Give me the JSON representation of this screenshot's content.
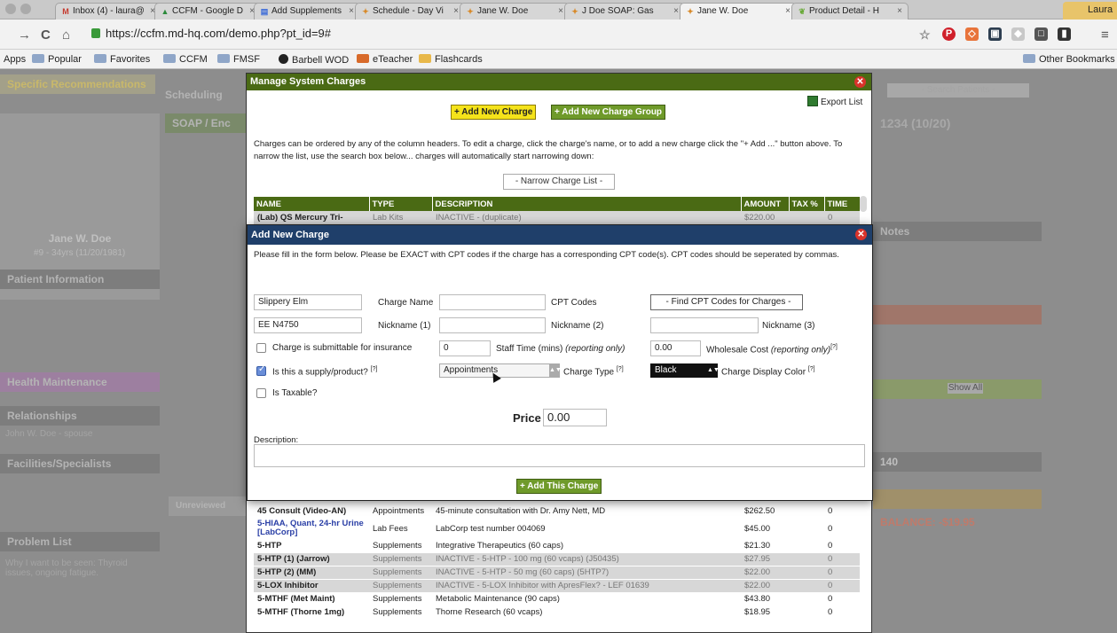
{
  "browser": {
    "tabs": [
      {
        "label": "Inbox (4) - laura@",
        "icon": "gmail-icon",
        "active": false
      },
      {
        "label": "CCFM - Google D",
        "icon": "drive-icon",
        "active": false
      },
      {
        "label": "Add Supplements",
        "icon": "docs-icon",
        "active": false
      },
      {
        "label": "Schedule - Day Vi",
        "icon": "mdhq-icon",
        "active": false
      },
      {
        "label": "Jane W. Doe",
        "icon": "mdhq-icon",
        "active": false
      },
      {
        "label": "J Doe SOAP: Gas",
        "icon": "mdhq-icon",
        "active": false
      },
      {
        "label": "Jane W. Doe",
        "icon": "mdhq-icon",
        "active": true
      },
      {
        "label": "Product Detail - H",
        "icon": "leaf-icon",
        "active": false
      }
    ],
    "profile": "Laura",
    "url": "https://ccfm.md-hq.com/demo.php?pt_id=9#",
    "bookmarks": [
      {
        "label": "Apps",
        "icon": "apps-icon"
      },
      {
        "label": "Popular",
        "icon": "folder-icon"
      },
      {
        "label": "Favorites",
        "icon": "folder-icon"
      },
      {
        "label": "CCFM",
        "icon": "folder-icon"
      },
      {
        "label": "FMSF",
        "icon": "folder-icon"
      },
      {
        "label": "Barbell WOD",
        "icon": "barbell-icon"
      },
      {
        "label": "eTeacher",
        "icon": "eteacher-icon"
      },
      {
        "label": "Flashcards",
        "icon": "flashcards-icon"
      }
    ],
    "other_bookmarks": "Other Bookmarks"
  },
  "background": {
    "specific_recommendations": "Specific Recommendations",
    "scheduling": "Scheduling",
    "soap": "SOAP / Enc",
    "patient_name": "Jane W. Doe",
    "patient_sub": "#9 - 34yrs (11/20/1981)",
    "patient_information": "Patient Information",
    "health_maintenance": "Health Maintenance",
    "relationships": "Relationships",
    "relationship_item": "John W. Doe - spouse",
    "facilities": "Facilities/Specialists",
    "problem_list": "Problem List",
    "problem_text": "Why I want to be seen: Thyroid issues, ongoing fatigue.",
    "search_placeholder": "- Search Patients -",
    "appt": "1234 (10/20)",
    "notes": "Notes",
    "unreviewed": "Unreviewed",
    "balance": "BALANCE: -$19.95",
    "vitals": "140",
    "show_all": "Show All"
  },
  "manage_charges": {
    "title": "Manage System Charges",
    "add_charge_btn": "+ Add New Charge",
    "add_group_btn": "+ Add New Charge Group",
    "export": "Export List",
    "intro": "Charges can be ordered by any of the column headers. To edit a charge, click the charge's name, or to add a new charge click the \"+ Add ...\" button above. To narrow the list, use the search box below... charges will automatically start narrowing down:",
    "narrow": "- Narrow Charge List -",
    "headers": [
      "NAME",
      "TYPE",
      "DESCRIPTION",
      "AMOUNT",
      "TAX %",
      "TIME"
    ],
    "top_rows": [
      {
        "name": "(Lab) QS Mercury Tri-",
        "type": "Lab Kits",
        "description": "INACTIVE - (duplicate)",
        "amount": "$220.00",
        "tax": "",
        "time": "0",
        "inactive": true,
        "style": "purple"
      }
    ],
    "rows": [
      {
        "name": "45 Consult (Video-AN)",
        "type": "Appointments",
        "description": "45-minute consultation with Dr. Amy Nett, MD",
        "amount": "$262.50",
        "tax": "",
        "time": "0",
        "inactive": false,
        "style": ""
      },
      {
        "name": "5-HIAA, Quant, 24-hr Urine [LabCorp]",
        "type": "Lab Fees",
        "description": "LabCorp test number 004069",
        "amount": "$45.00",
        "tax": "",
        "time": "0",
        "inactive": false,
        "style": "link"
      },
      {
        "name": "5-HTP",
        "type": "Supplements",
        "description": "Integrative Therapeutics (60 caps)",
        "amount": "$21.30",
        "tax": "",
        "time": "0",
        "inactive": false,
        "style": ""
      },
      {
        "name": "5-HTP (1) (Jarrow)",
        "type": "Supplements",
        "description": "INACTIVE - 5-HTP - 100 mg (60 vcaps) (J50435)",
        "amount": "$27.95",
        "tax": "",
        "time": "0",
        "inactive": true,
        "style": ""
      },
      {
        "name": "5-HTP (2) (MM)",
        "type": "Supplements",
        "description": "INACTIVE - 5-HTP - 50 mg (60 caps) (5HTP7)",
        "amount": "$22.00",
        "tax": "",
        "time": "0",
        "inactive": true,
        "style": ""
      },
      {
        "name": "5-LOX Inhibitor",
        "type": "Supplements",
        "description": "INACTIVE - 5-LOX Inhibitor with ApresFlex? - LEF 01639",
        "amount": "$22.00",
        "tax": "",
        "time": "0",
        "inactive": true,
        "style": ""
      },
      {
        "name": "5-MTHF (Met Maint)",
        "type": "Supplements",
        "description": "Metabolic Maintenance (90 caps)",
        "amount": "$43.80",
        "tax": "",
        "time": "0",
        "inactive": false,
        "style": ""
      },
      {
        "name": "5-MTHF (Thorne 1mg)",
        "type": "Supplements",
        "description": "Thorne Research (60 vcaps)",
        "amount": "$18.95",
        "tax": "",
        "time": "0",
        "inactive": false,
        "style": ""
      }
    ]
  },
  "add_charge": {
    "title": "Add New Charge",
    "intro": "Please fill in the form below. Please be EXACT with CPT codes if the charge has a corresponding CPT code(s). CPT codes should be seperated by commas.",
    "charge_name_value": "Slippery Elm",
    "charge_name_label": "Charge Name",
    "cpt_codes_value": "",
    "cpt_codes_label": "CPT Codes",
    "find_cpt_btn": "- Find CPT Codes for Charges -",
    "nickname1_value": "EE N4750",
    "nickname1_label": "Nickname (1)",
    "nickname2_value": "",
    "nickname2_label": "Nickname (2)",
    "nickname3_value": "",
    "nickname3_label": "Nickname (3)",
    "insurance_label": "Charge is submittable for insurance",
    "staff_time_value": "0",
    "staff_time_label": "Staff Time (mins)",
    "staff_time_note": "(reporting only)",
    "wholesale_value": "0.00",
    "wholesale_label": "Wholesale Cost",
    "wholesale_note": "(reporting only)",
    "supply_label": "Is this a supply/product?",
    "charge_type_value": "Appointments",
    "charge_type_label": "Charge Type",
    "display_color_value": "Black",
    "display_color_label": "Charge Display Color",
    "taxable_label": "Is Taxable?",
    "help": "[?]",
    "price_label": "Price",
    "price_value": "0.00",
    "description_label": "Description:",
    "submit_btn": "+ Add This Charge",
    "supply_checked": true,
    "insurance_checked": false,
    "taxable_checked": false
  },
  "colors": {
    "manage_header": "#4a6a14",
    "add_header": "#1f3f6a",
    "yellow_button": "#f5e31a",
    "green_button": "#6f9a2a",
    "close": "#d9332b"
  }
}
